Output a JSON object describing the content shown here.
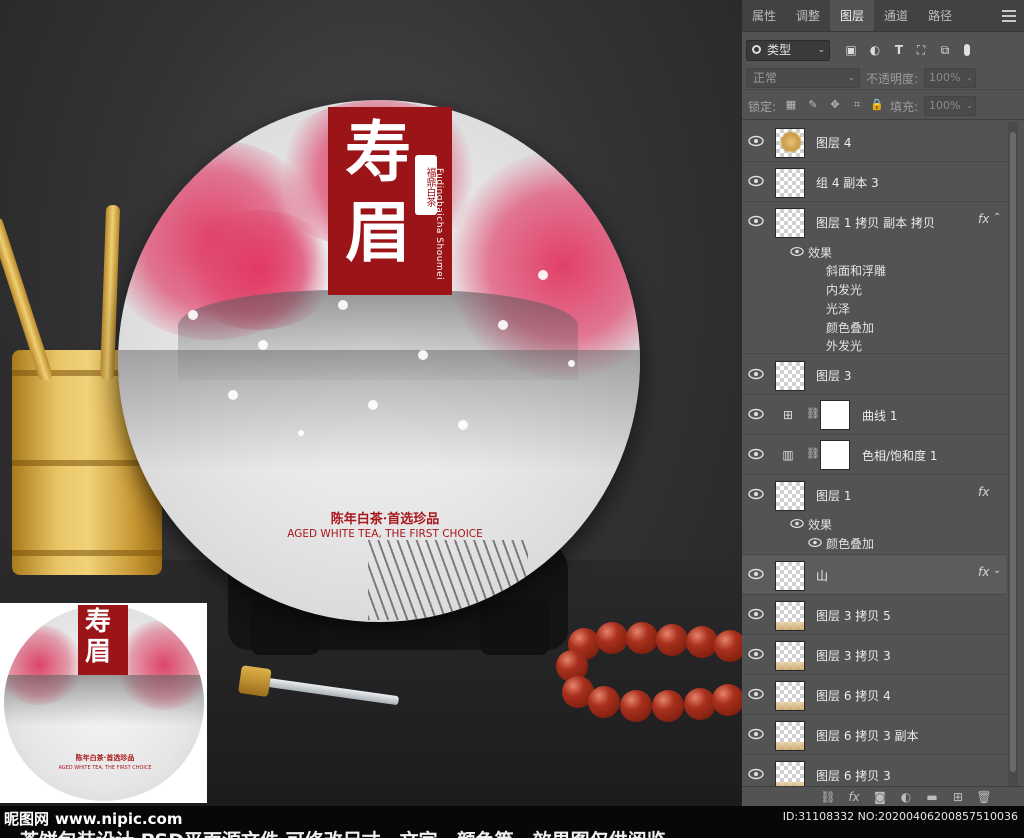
{
  "photo": {
    "cake_title": "寿眉",
    "cake_seal": "福鼎白茶",
    "cake_pinyin": "Fudingbaicha Shoumei",
    "cake_cn": "陈年白茶·首选珍品",
    "cake_en": "AGED WHITE TEA, THE FIRST CHOICE"
  },
  "thumbnail": {
    "title": "寿眉",
    "cn": "陈年白茶·首选珍品",
    "en": "AGED WHITE TEA, THE FIRST CHOICE"
  },
  "panel": {
    "tabs": [
      {
        "label": "属性",
        "active": false
      },
      {
        "label": "调整",
        "active": false
      },
      {
        "label": "图层",
        "active": true
      },
      {
        "label": "通道",
        "active": false
      },
      {
        "label": "路径",
        "active": false
      }
    ],
    "filter": {
      "label": "类型"
    },
    "blend_mode": "正常",
    "opacity_label": "不透明度:",
    "opacity_value": "100%",
    "lock_label": "锁定:",
    "fill_label": "填充:",
    "fill_value": "100%",
    "layers": [
      {
        "name": "图层 4",
        "fx": false
      },
      {
        "name": "组 4 副本 3",
        "fx": false
      },
      {
        "name": "图层 1 拷贝 副本 拷贝",
        "fx": true,
        "effects_label": "效果",
        "effects": [
          "斜面和浮雕",
          "内发光",
          "光泽",
          "颜色叠加",
          "外发光"
        ]
      },
      {
        "name": "图层 3",
        "fx": false
      },
      {
        "name": "曲线 1",
        "fx": false,
        "adjustment": "curves"
      },
      {
        "name": "色相/饱和度 1",
        "fx": false,
        "adjustment": "hue-saturation"
      },
      {
        "name": "图层 1",
        "fx": true,
        "effects_label": "效果",
        "effects": [
          "颜色叠加"
        ]
      },
      {
        "name": "山",
        "fx": true
      },
      {
        "name": "图层 3 拷贝 5",
        "fx": false
      },
      {
        "name": "图层 3 拷贝 3",
        "fx": false
      },
      {
        "name": "图层 6 拷贝 4",
        "fx": false
      },
      {
        "name": "图层 6 拷贝 3 副本",
        "fx": false
      },
      {
        "name": "图层 6 拷贝 3",
        "fx": false
      }
    ],
    "footer_icons": [
      "link-icon",
      "fx-icon",
      "mask-icon",
      "adjustment-icon",
      "folder-icon",
      "new-layer-icon",
      "trash-icon"
    ]
  },
  "banner": {
    "brand": "昵图网",
    "url": "www.nipic.com",
    "id_line": "ID:31108332 NO:20200406200857510036",
    "description": "茶饼包装设计 PSD平面源文件 可修改尺寸、文字、颜色等。效果图仅供阅览"
  },
  "colors": {
    "label_red": "#9b1417",
    "panel_bg": "#535353",
    "tab_bar_bg": "#424242"
  }
}
